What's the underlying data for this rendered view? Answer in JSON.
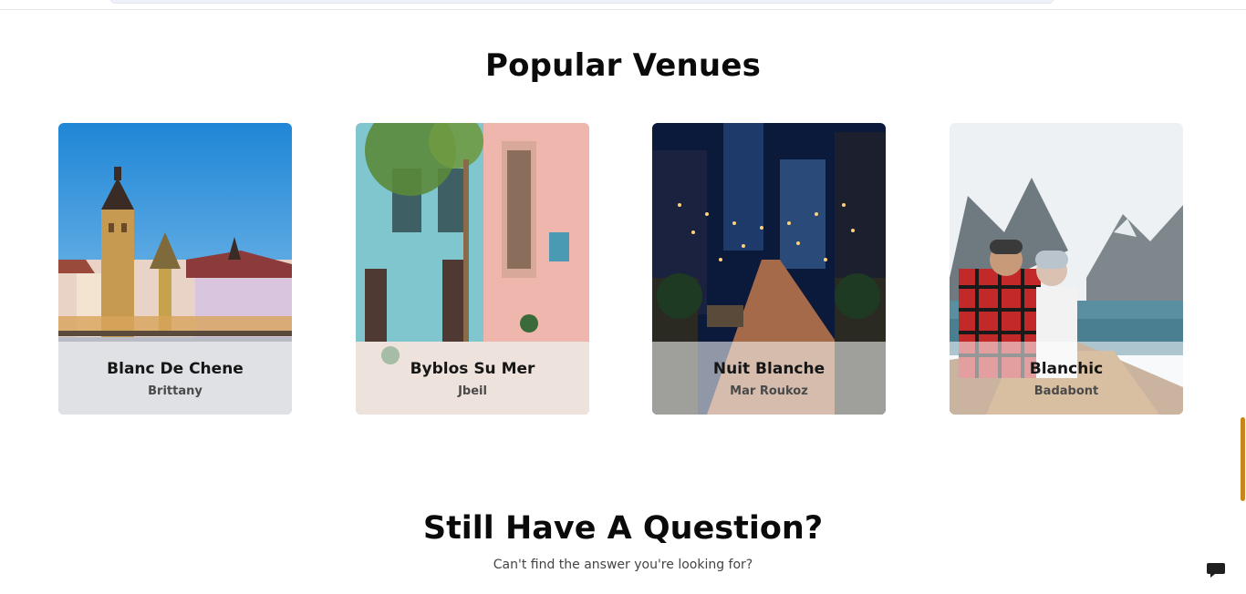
{
  "popular_venues": {
    "title": "Popular Venues",
    "venues": [
      {
        "name": "Blanc De Chene",
        "location": "Brittany"
      },
      {
        "name": "Byblos Su Mer",
        "location": "Jbeil"
      },
      {
        "name": "Nuit Blanche",
        "location": "Mar Roukoz"
      },
      {
        "name": "Blanchic",
        "location": "Badabont"
      }
    ]
  },
  "faq": {
    "title": "Still Have A Question?",
    "subtitle": "Can't find the answer you're looking for?"
  },
  "icons": {
    "chat": "chat-bubble-icon"
  },
  "colors": {
    "scroll_accent": "#c8871a"
  }
}
